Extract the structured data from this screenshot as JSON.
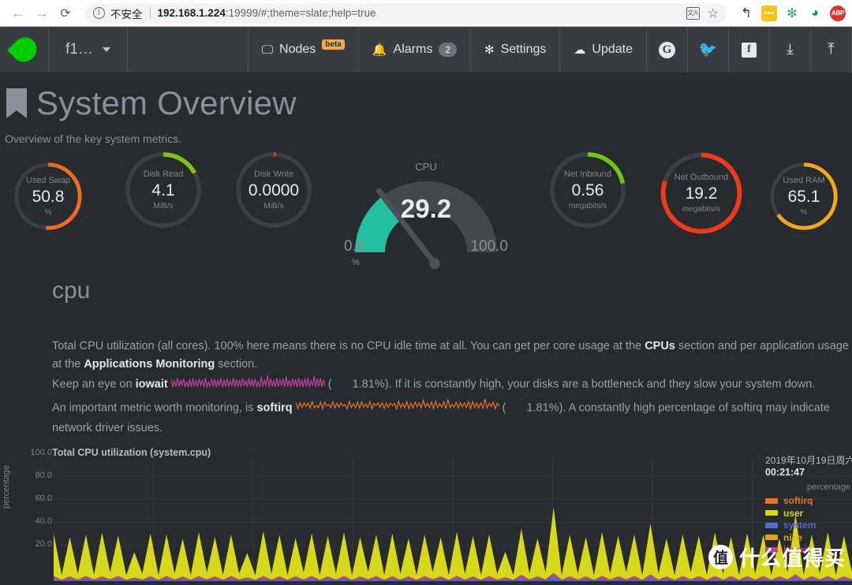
{
  "browser": {
    "back_icon": "back-arrow-icon",
    "forward_icon": "forward-arrow-icon",
    "reload_icon": "reload-icon",
    "info_glyph": "i",
    "insecure_label": "不安全",
    "url_host": "192.168.1.224",
    "url_rest": ":19999/#;theme=slate;help=true",
    "translate_glyph": "文A",
    "star_glyph": "☆",
    "extensions": [
      {
        "name": "undo-extension-icon",
        "glyph": "↰"
      },
      {
        "name": "dots-extension-icon",
        "glyph": "•••"
      },
      {
        "name": "puzzle-extension-icon",
        "glyph": "✻"
      },
      {
        "name": "globe-extension-icon",
        "glyph": "◕"
      },
      {
        "name": "adblock-extension-icon",
        "glyph": "ABP"
      }
    ]
  },
  "nav": {
    "logo_name": "netdata-logo",
    "hostname": "f1…",
    "items": [
      {
        "name": "nodes",
        "icon": "monitor-icon",
        "glyph": "🖵",
        "label": "Nodes",
        "badge": "beta",
        "badge_type": "beta"
      },
      {
        "name": "alarms",
        "icon": "bell-icon",
        "glyph": "🔔",
        "label": "Alarms",
        "badge": "2",
        "badge_type": "count"
      },
      {
        "name": "settings",
        "icon": "gear-icon",
        "glyph": "✻",
        "label": "Settings",
        "badge": "",
        "badge_type": ""
      },
      {
        "name": "update",
        "icon": "cloud-download-icon",
        "glyph": "☁",
        "label": "Update",
        "badge": "",
        "badge_type": ""
      }
    ],
    "social": [
      {
        "name": "github-icon",
        "glyph": "G"
      },
      {
        "name": "twitter-icon",
        "glyph": "🐦"
      },
      {
        "name": "facebook-icon",
        "glyph": "f"
      },
      {
        "name": "download-icon",
        "glyph": "⤓"
      },
      {
        "name": "upload-icon",
        "glyph": "⤒"
      }
    ]
  },
  "page": {
    "title": "System Overview",
    "subtitle": "Overview of the key system metrics.",
    "bookmark_icon": "bookmark-icon"
  },
  "gauges": [
    {
      "name": "used-swap",
      "title": "Used Swap",
      "value": "50.8",
      "unit": "%",
      "color": "#ee6b1f",
      "pct": 51,
      "type": "ring"
    },
    {
      "name": "disk-read",
      "title": "Disk Read",
      "value": "4.1",
      "unit": "MiB/s",
      "color": "#7fc318",
      "pct": 17,
      "type": "ring"
    },
    {
      "name": "disk-write",
      "title": "Disk Write",
      "value": "0.0000",
      "unit": "MiB/s",
      "color": "#e8391c",
      "pct": 1,
      "type": "ring"
    },
    {
      "name": "net-inbound",
      "title": "Net Inbound",
      "value": "0.56",
      "unit": "megabits/s",
      "color": "#6ec80f",
      "pct": 22,
      "type": "ring"
    },
    {
      "name": "net-outbound",
      "title": "Net Outbound",
      "value": "19.2",
      "unit": "megabits/s",
      "color": "#f03a17",
      "pct": 80,
      "type": "ring"
    },
    {
      "name": "used-ram",
      "title": "Used RAM",
      "value": "65.1",
      "unit": "%",
      "color": "#f0a81e",
      "pct": 65,
      "type": "ring"
    }
  ],
  "cpu_gauge": {
    "name": "cpu-gauge",
    "title": "CPU",
    "value": "29.2",
    "min": "0.0",
    "max": "100.0",
    "unit": "%",
    "fill_color": "#22bfa2",
    "track_color": "#43484e",
    "needle_color": "#4b5157",
    "pct": 29.2
  },
  "section": {
    "heading": "cpu",
    "desc_1a": "Total CPU utilization (all cores). 100% here means there is no CPU idle time at all. You can get per core usage at the ",
    "link_cpus": "CPUs",
    "desc_1b": " section and per application usage at the ",
    "link_apps": "Applications Monitoring",
    "desc_1c": " section.",
    "desc_2a": "Keep an eye on ",
    "term_iowait": "iowait",
    "desc_2b": "(",
    "iowait_value": "1.81%",
    "desc_2c": "). If it is constantly high, your disks are a bottleneck and they slow your system down.",
    "desc_3a": "An important metric worth monitoring, is ",
    "term_softirq": "softirq",
    "desc_3b": "(",
    "softirq_value": "1.81%",
    "desc_3c": "). A constantly high percentage of softirq may indicate network driver issues.",
    "iowait_spark_color": "#c0409c",
    "softirq_spark_color": "#e2762c"
  },
  "chart_legend": {
    "date": "2019年10月19日周六",
    "time": "00:21:47",
    "unit": "percentage"
  },
  "watermark": {
    "logo_glyph": "值",
    "text": "什么值得买"
  },
  "chart_data": {
    "type": "area",
    "title": "Total CPU utilization (system.cpu)",
    "xlabel": "",
    "ylabel": "percentage",
    "ylim": [
      0,
      100
    ],
    "yticks": [
      100.0,
      80.0,
      60.0,
      40.0,
      20.0
    ],
    "grid": true,
    "legend_position": "right",
    "stacked": true,
    "series": [
      {
        "name": "softirq",
        "color": "#e2762c",
        "values": [
          0.4,
          0.3,
          0.5,
          0.4,
          0.3,
          0.6,
          0.4,
          0.3,
          0.5,
          0.4,
          0.3,
          0.4,
          0.5,
          0.3,
          0.4,
          0.6,
          0.3,
          0.4,
          0.5,
          0.3,
          0.4,
          0.5,
          0.3,
          0.6,
          0.4,
          0.3,
          0.5,
          0.4,
          0.3,
          0.4,
          0.6,
          0.3,
          0.4,
          0.5,
          0.3,
          0.4,
          0.5,
          0.3,
          0.4,
          0.6,
          0.3,
          0.5,
          0.4,
          0.3,
          0.4,
          0.5,
          0.3,
          0.6,
          0.4,
          0.3,
          0.5,
          0.4,
          0.3,
          0.4,
          0.5,
          0.3,
          0.6,
          0.4,
          0.3,
          0.5,
          0.4,
          0.3,
          0.4,
          0.5,
          0.3,
          0.4,
          0.6,
          0.3,
          0.5,
          0.4,
          0.3,
          0.4,
          0.5,
          0.3,
          0.6,
          0.4,
          0.3,
          0.5,
          0.4,
          0.3,
          0.4,
          0.5,
          0.3,
          0.4,
          0.6,
          0.3,
          0.5,
          0.4,
          0.3,
          0.4,
          0.5,
          0.3,
          0.6,
          0.4,
          0.3,
          0.5,
          0.4,
          0.3,
          0.4,
          0.5
        ]
      },
      {
        "name": "user",
        "color": "#d8d81a",
        "values": [
          37,
          4,
          34,
          5,
          36,
          4,
          38,
          6,
          35,
          4,
          22,
          5,
          37,
          4,
          36,
          5,
          33,
          4,
          38,
          6,
          34,
          4,
          36,
          5,
          21,
          4,
          39,
          5,
          36,
          4,
          33,
          6,
          37,
          4,
          35,
          5,
          38,
          4,
          34,
          6,
          36,
          4,
          37,
          5,
          33,
          4,
          36,
          6,
          34,
          4,
          38,
          5,
          35,
          4,
          36,
          5,
          22,
          4,
          40,
          5,
          33,
          6,
          57,
          4,
          36,
          5,
          34,
          4,
          38,
          5,
          35,
          6,
          36,
          4,
          44,
          5,
          33,
          4,
          36,
          6,
          35,
          4,
          38,
          5,
          34,
          4,
          37,
          5,
          36,
          4,
          33,
          6,
          52,
          4,
          36,
          5,
          38,
          4,
          35,
          6
        ]
      },
      {
        "name": "system",
        "color": "#4f6fd0",
        "values": [
          2,
          0.5,
          2,
          0.4,
          2,
          0.5,
          2,
          0.6,
          2,
          0.4,
          1.5,
          0.5,
          2,
          0.4,
          2,
          0.5,
          2,
          0.4,
          2,
          0.6,
          2,
          0.4,
          2,
          0.5,
          1.5,
          0.4,
          2,
          0.5,
          2,
          0.4,
          2,
          0.6,
          2,
          0.4,
          2,
          0.5,
          2,
          0.4,
          2,
          0.6,
          2,
          0.4,
          2,
          0.5,
          2,
          0.4,
          2,
          0.6,
          2,
          0.4,
          2,
          0.5,
          2,
          0.4,
          2,
          0.5,
          1.5,
          0.4,
          3,
          0.5,
          2,
          0.6,
          4,
          0.4,
          2,
          0.5,
          2,
          0.4,
          2,
          0.5,
          2,
          0.6,
          2,
          0.4,
          3,
          0.5,
          2,
          0.4,
          2,
          0.6,
          2,
          0.4,
          2,
          0.5,
          2,
          0.4,
          2,
          0.5,
          2,
          0.4,
          2,
          0.6,
          3,
          0.4,
          2,
          0.5,
          2,
          0.4,
          2,
          0.6
        ]
      },
      {
        "name": "nice",
        "color": "#e0a21e",
        "values": [
          0.2,
          0.1,
          0.2,
          0.1,
          0.2,
          0.1,
          0.2,
          0.1,
          0.2,
          0.1,
          0.2,
          0.1,
          0.2,
          0.1,
          0.2,
          0.1,
          0.2,
          0.1,
          0.2,
          0.1,
          0.2,
          0.1,
          0.2,
          0.1,
          0.2,
          0.1,
          0.2,
          0.1,
          0.2,
          0.1,
          0.2,
          0.1,
          0.2,
          0.1,
          0.2,
          0.1,
          0.2,
          0.1,
          0.2,
          0.1,
          0.2,
          0.1,
          0.2,
          0.1,
          0.2,
          0.1,
          0.2,
          0.1,
          0.2,
          0.1,
          0.2,
          0.1,
          0.2,
          0.1,
          0.2,
          0.1,
          0.2,
          0.1,
          0.2,
          0.1,
          0.2,
          0.1,
          0.2,
          0.1,
          0.2,
          0.1,
          0.2,
          0.1,
          0.2,
          0.1,
          0.2,
          0.1,
          0.2,
          0.1,
          0.2,
          0.1,
          0.2,
          0.1,
          0.2,
          0.1,
          0.2,
          0.1,
          0.2,
          0.1,
          0.2,
          0.1,
          0.2,
          0.1,
          0.2,
          0.1,
          0.2,
          0.1,
          0.2,
          0.1,
          0.2,
          0.1,
          0.2,
          0.1,
          0.2,
          0.1
        ]
      },
      {
        "name": "iowait",
        "color": "#c0409c",
        "values": [
          1.8,
          0.3,
          1.5,
          0.4,
          1.9,
          0.3,
          1.6,
          0.5,
          1.8,
          0.3,
          1.2,
          0.4,
          1.7,
          0.3,
          1.9,
          0.4,
          1.5,
          0.3,
          1.8,
          0.5,
          1.6,
          0.3,
          1.9,
          0.4,
          1.2,
          0.3,
          1.8,
          0.4,
          1.7,
          0.3,
          1.5,
          0.5,
          1.9,
          0.3,
          1.6,
          0.4,
          1.8,
          0.3,
          1.5,
          0.5,
          1.9,
          0.3,
          1.7,
          0.4,
          1.6,
          0.3,
          1.8,
          0.5,
          1.5,
          0.3,
          1.9,
          0.4,
          1.7,
          0.3,
          1.8,
          0.4,
          1.2,
          0.3,
          2.1,
          0.4,
          1.6,
          0.5,
          2.4,
          0.3,
          1.8,
          0.4,
          1.5,
          0.3,
          1.9,
          0.4,
          1.7,
          0.5,
          1.8,
          0.3,
          2.2,
          0.4,
          1.5,
          0.3,
          1.8,
          0.5,
          1.7,
          0.3,
          1.9,
          0.4,
          1.6,
          0.3,
          1.8,
          0.4,
          1.9,
          0.3,
          1.5,
          0.5,
          2.3,
          0.3,
          1.8,
          0.4,
          1.9,
          0.3,
          1.6,
          0.5
        ]
      }
    ],
    "legend_entries": [
      {
        "label": "softirq",
        "color": "#e2762c"
      },
      {
        "label": "user",
        "color": "#d8d81a"
      },
      {
        "label": "system",
        "color": "#4f6fd0"
      },
      {
        "label": "nice",
        "color": "#e0a21e"
      },
      {
        "label": "iowait",
        "color": "#c0409c"
      }
    ]
  }
}
